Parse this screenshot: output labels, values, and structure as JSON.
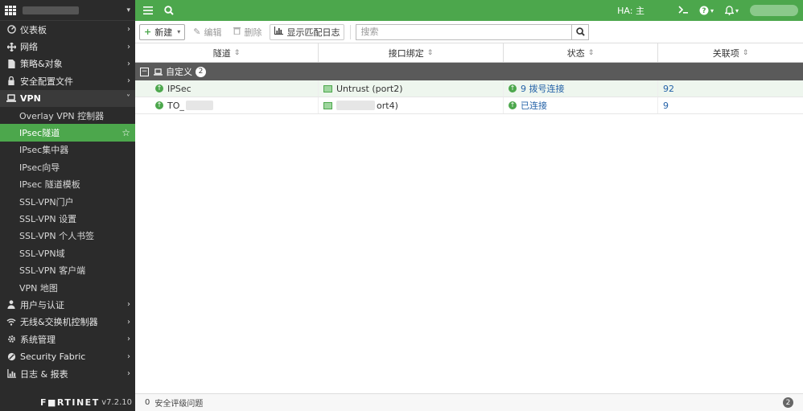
{
  "sidebar": {
    "items": [
      {
        "label": "仪表板",
        "icon": "dashboard-icon"
      },
      {
        "label": "网络",
        "icon": "network-icon"
      },
      {
        "label": "策略&对象",
        "icon": "policy-icon"
      },
      {
        "label": "安全配置文件",
        "icon": "lock-icon"
      },
      {
        "label": "VPN",
        "icon": "laptop-icon"
      }
    ],
    "vpn_sub": [
      {
        "label": "Overlay VPN 控制器"
      },
      {
        "label": "IPsec隧道"
      },
      {
        "label": "IPsec集中器"
      },
      {
        "label": "IPsec向导"
      },
      {
        "label": "IPsec 隧道模板"
      },
      {
        "label": "SSL-VPN门户"
      },
      {
        "label": "SSL-VPN 设置"
      },
      {
        "label": "SSL-VPN 个人书签"
      },
      {
        "label": "SSL-VPN域"
      },
      {
        "label": "SSL-VPN 客户端"
      },
      {
        "label": "VPN 地图"
      }
    ],
    "items_after": [
      {
        "label": "用户与认证",
        "icon": "user-icon"
      },
      {
        "label": "无线&交换机控制器",
        "icon": "wifi-icon"
      },
      {
        "label": "系统管理",
        "icon": "gear-icon"
      },
      {
        "label": "Security Fabric",
        "icon": "fabric-icon"
      },
      {
        "label": "日志 & 报表",
        "icon": "chart-icon"
      }
    ],
    "brand": "F■RTINET",
    "version": "v7.2.10"
  },
  "topbar": {
    "ha": "HA: 主"
  },
  "toolbar": {
    "new_label": "新建",
    "edit_label": "编辑",
    "delete_label": "删除",
    "log_label": "显示匹配日志",
    "search_placeholder": "搜索"
  },
  "table": {
    "columns": [
      "隧道",
      "接口绑定",
      "状态",
      "关联项"
    ],
    "group": {
      "label": "自定义",
      "count": "2"
    },
    "rows": [
      {
        "tunnel": "IPSec",
        "interface": "Untrust (port2)",
        "status": "9 拨号连接",
        "refs": "92"
      },
      {
        "tunnel": "TO_",
        "interface": "ort4)",
        "status": "已连接",
        "refs": "9"
      }
    ]
  },
  "statusbar": {
    "count": "0",
    "text": "安全评级问题",
    "badge": "2"
  },
  "colors": {
    "accent": "#4ca74c",
    "sidebar_bg": "#2b2b2b",
    "link": "#2563a8"
  }
}
